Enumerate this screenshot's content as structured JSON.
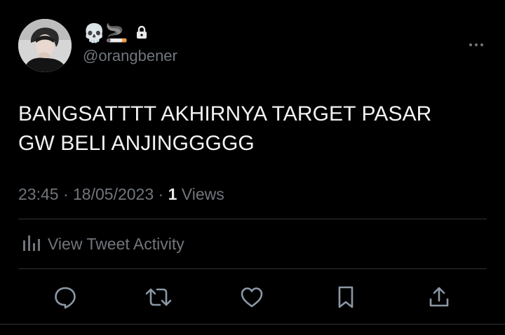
{
  "author": {
    "display_name": "💀🚬",
    "handle": "@orangbener",
    "protected_icon": "lock-icon",
    "avatar": "user-avatar"
  },
  "tweet": {
    "text_line1": "BANGSATTTT AKHIRNYA TARGET PASAR",
    "text_line2": "GW BELI ANJINGGGGG",
    "time": "23:45",
    "date": "18/05/2023",
    "views_count": "1",
    "views_label": "Views",
    "separator": "·"
  },
  "activity": {
    "label": "View Tweet Activity",
    "icon": "bar-chart-icon"
  },
  "actions": [
    {
      "name": "reply",
      "icon": "speech-bubble-icon"
    },
    {
      "name": "retweet",
      "icon": "retweet-arrows-icon"
    },
    {
      "name": "like",
      "icon": "heart-icon"
    },
    {
      "name": "bookmark",
      "icon": "bookmark-icon"
    },
    {
      "name": "share",
      "icon": "share-upload-icon"
    }
  ],
  "colors": {
    "background": "#000000",
    "primary_text": "#e7e9ea",
    "secondary_text": "#71767b",
    "divider": "#2f3336"
  }
}
